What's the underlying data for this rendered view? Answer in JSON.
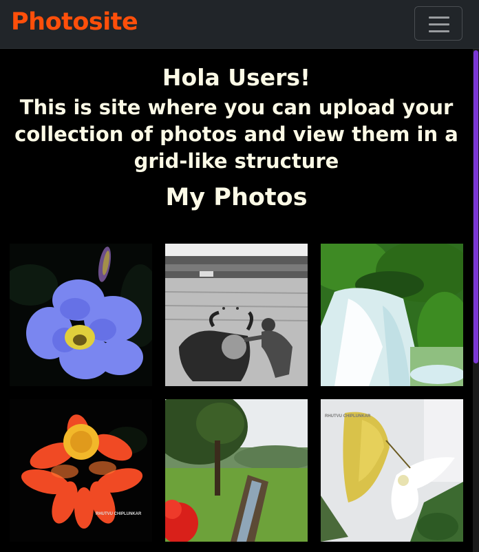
{
  "navbar": {
    "brand": "Photosite",
    "brand_color": "#ff4f0a",
    "menu_icon": "hamburger-icon"
  },
  "main": {
    "greeting": "Hola Users!",
    "intro": "This is site where you can upload your collection of photos and view them in a grid-like structure",
    "section_title": "My Photos"
  },
  "photos": [
    {
      "subject": "blue flower"
    },
    {
      "subject": "man washing buffalo in river"
    },
    {
      "subject": "waterfall"
    },
    {
      "subject": "red-orange flower",
      "watermark": "RHUTVU CHIPLUNKAR"
    },
    {
      "subject": "park with tree and stream"
    },
    {
      "subject": "yellow butterfly on white flower",
      "watermark": "RHUTVU CHIPLUNKAR"
    }
  ],
  "colors": {
    "page_background": "#000000",
    "navbar_background": "#212529",
    "text": "#fcfae6",
    "scrollbar_thumb": "#7b38d6"
  }
}
